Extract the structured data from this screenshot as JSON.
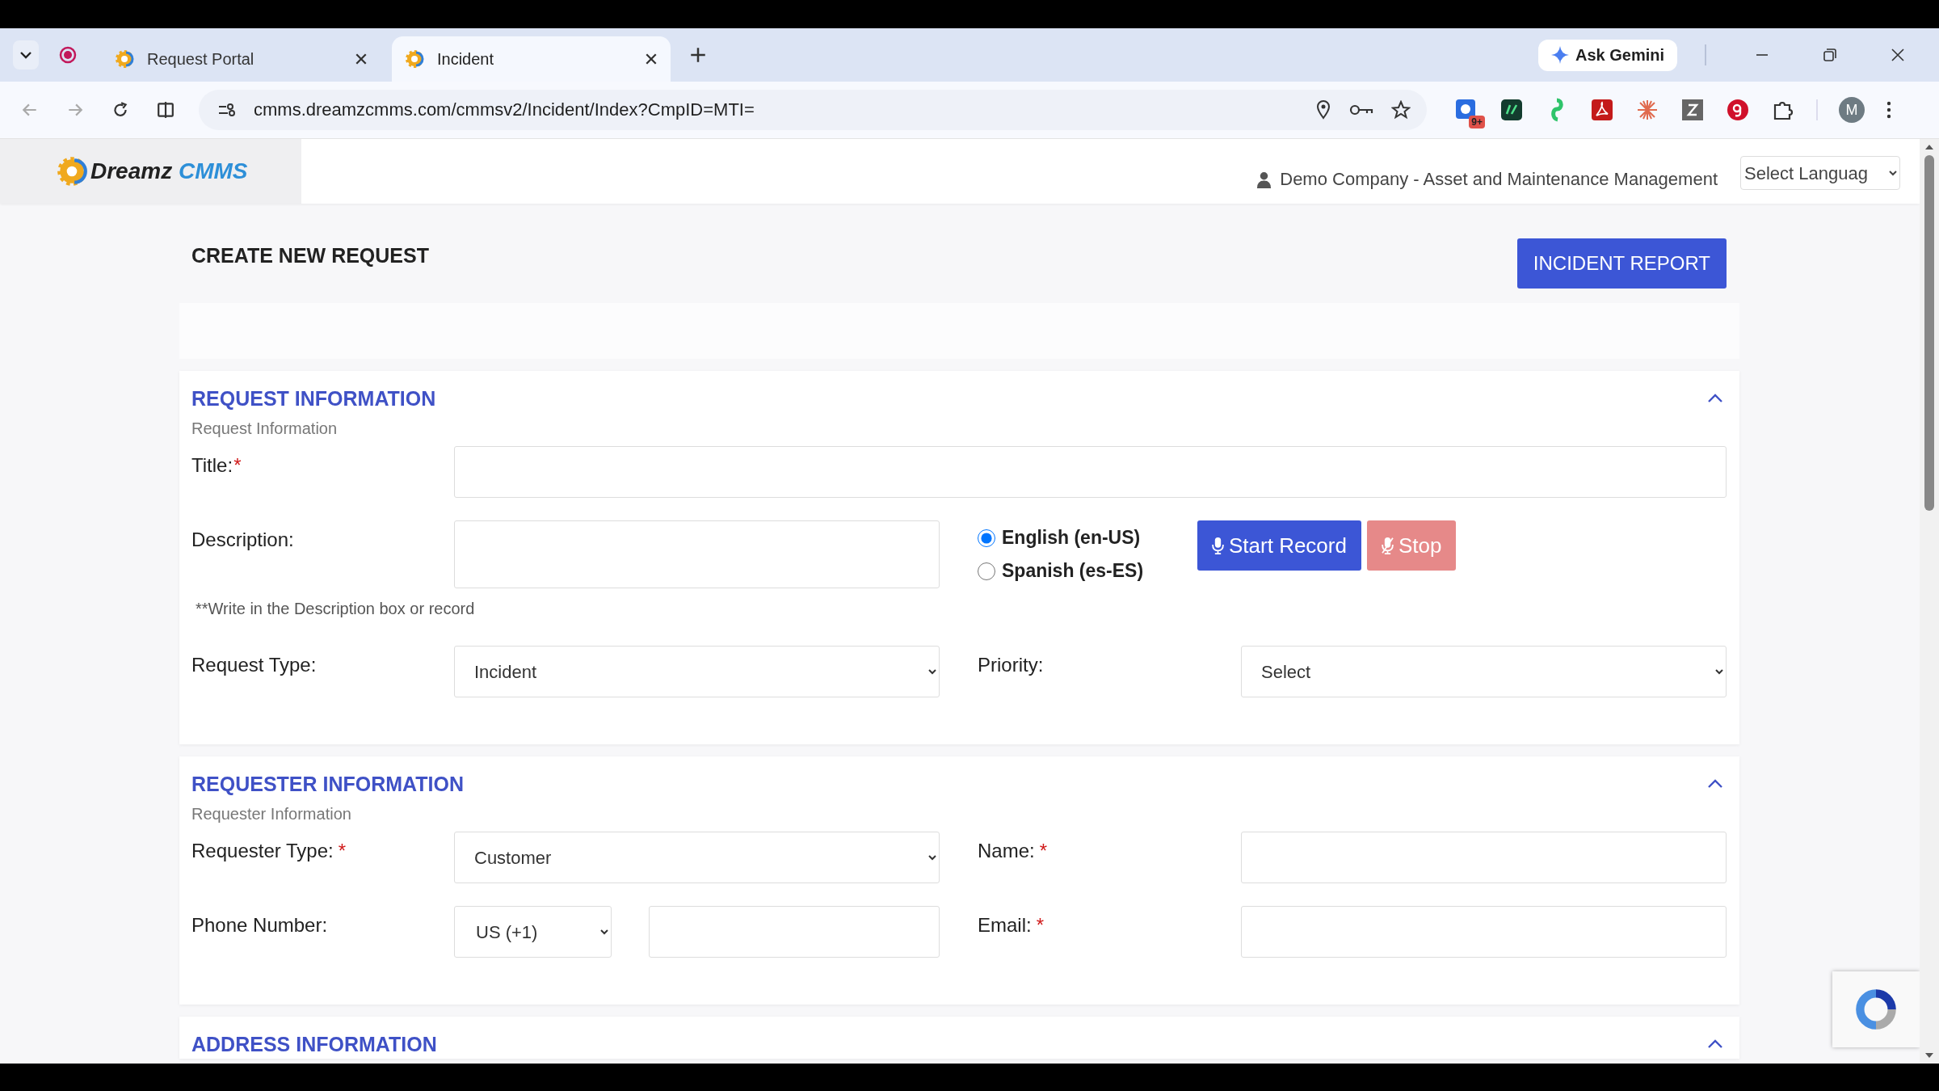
{
  "browser": {
    "tabs": [
      {
        "title": "Request Portal",
        "selected": false
      },
      {
        "title": "Incident",
        "selected": true
      }
    ],
    "address": "cmms.dreamzcmms.com/cmmsv2/Incident/Index?CmpID=MTI=",
    "ask_button": "Ask Gemini",
    "extension_badge": "9+",
    "profile_initial": "M"
  },
  "header": {
    "logo": {
      "word_1": "Dreamz",
      "word_2": "CMMS"
    },
    "company": "Demo Company - Asset and Maintenance Management",
    "language_select": "Select Languag"
  },
  "page_title": "CREATE NEW REQUEST",
  "report_button": "INCIDENT REPORT",
  "request_information": {
    "title": "REQUEST INFORMATION",
    "subtitle": "Request Information",
    "expanded": true,
    "title_field": {
      "label": "Title:",
      "mark": "*"
    },
    "description": {
      "label": "Description:"
    },
    "languages": [
      {
        "label": "English (en-US)",
        "selected": true
      },
      {
        "label": "Spanish (es-ES)",
        "selected": false
      }
    ],
    "record_buttons": [
      {
        "label": "Start Record",
        "disabled": false
      },
      {
        "label": "Stop",
        "disabled": true
      }
    ],
    "note": "**Write in the Description box or record",
    "request_type": {
      "label": "Request Type:",
      "value": "Incident"
    },
    "priority": {
      "label": "Priority:",
      "value": "Select"
    }
  },
  "requester_information": {
    "title": "REQUESTER INFORMATION",
    "subtitle": "Requester Information",
    "expanded": true,
    "requester_type": {
      "label": "Requester Type:",
      "mark": "*",
      "value": "Customer"
    },
    "name": {
      "label": "Name:",
      "mark": "*"
    },
    "phone": {
      "label": "Phone Number:",
      "country": "US (+1)"
    },
    "email": {
      "label": "Email:",
      "mark": "*"
    }
  },
  "address_information": {
    "title": "ADDRESS INFORMATION",
    "expanded": true
  }
}
